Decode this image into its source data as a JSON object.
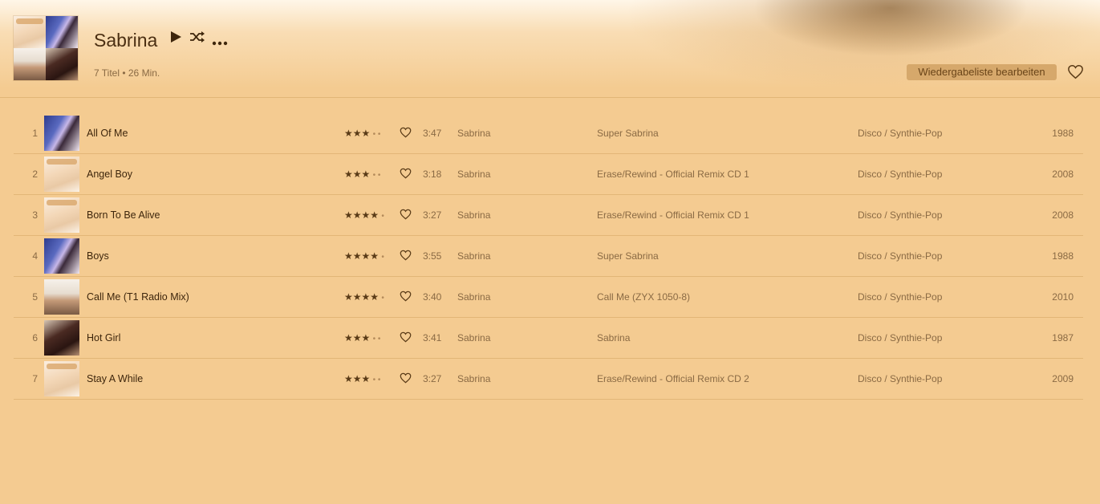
{
  "playlist": {
    "title": "Sabrina",
    "subtitle": "7 Titel • 26 Min.",
    "edit_label": "Wiedergabeliste bearbeiten"
  },
  "icons": {
    "play": "play-icon",
    "shuffle": "shuffle-icon",
    "more": "more-icon",
    "favorite": "heart-icon"
  },
  "colors": {
    "background": "#f4cb91",
    "text": "#5a3b17",
    "button": "#d6a86b"
  },
  "tracks": [
    {
      "num": "1",
      "name": "All Of Me",
      "stars": "★★★",
      "dots": "• •",
      "time": "3:47",
      "artist": "Sabrina",
      "album": "Super Sabrina",
      "genre": "Disco / Synthie-Pop",
      "year": "1988",
      "art": "art-b"
    },
    {
      "num": "2",
      "name": "Angel Boy",
      "stars": "★★★",
      "dots": "• •",
      "time": "3:18",
      "artist": "Sabrina",
      "album": "Erase/Rewind - Official Remix CD 1",
      "genre": "Disco / Synthie-Pop",
      "year": "2008",
      "art": "art-a"
    },
    {
      "num": "3",
      "name": "Born To Be Alive",
      "stars": "★★★★",
      "dots": "•",
      "time": "3:27",
      "artist": "Sabrina",
      "album": "Erase/Rewind - Official Remix CD 1",
      "genre": "Disco / Synthie-Pop",
      "year": "2008",
      "art": "art-a"
    },
    {
      "num": "4",
      "name": "Boys",
      "stars": "★★★★",
      "dots": "•",
      "time": "3:55",
      "artist": "Sabrina",
      "album": "Super Sabrina",
      "genre": "Disco / Synthie-Pop",
      "year": "1988",
      "art": "art-b"
    },
    {
      "num": "5",
      "name": "Call Me (T1 Radio Mix)",
      "stars": "★★★★",
      "dots": "•",
      "time": "3:40",
      "artist": "Sabrina",
      "album": "Call Me (ZYX 1050-8)",
      "genre": "Disco / Synthie-Pop",
      "year": "2010",
      "art": "art-c"
    },
    {
      "num": "6",
      "name": "Hot Girl",
      "stars": "★★★",
      "dots": "• •",
      "time": "3:41",
      "artist": "Sabrina",
      "album": "Sabrina",
      "genre": "Disco / Synthie-Pop",
      "year": "1987",
      "art": "art-d"
    },
    {
      "num": "7",
      "name": "Stay A While",
      "stars": "★★★",
      "dots": "• •",
      "time": "3:27",
      "artist": "Sabrina",
      "album": "Erase/Rewind - Official Remix CD 2",
      "genre": "Disco / Synthie-Pop",
      "year": "2009",
      "art": "art-a"
    }
  ]
}
